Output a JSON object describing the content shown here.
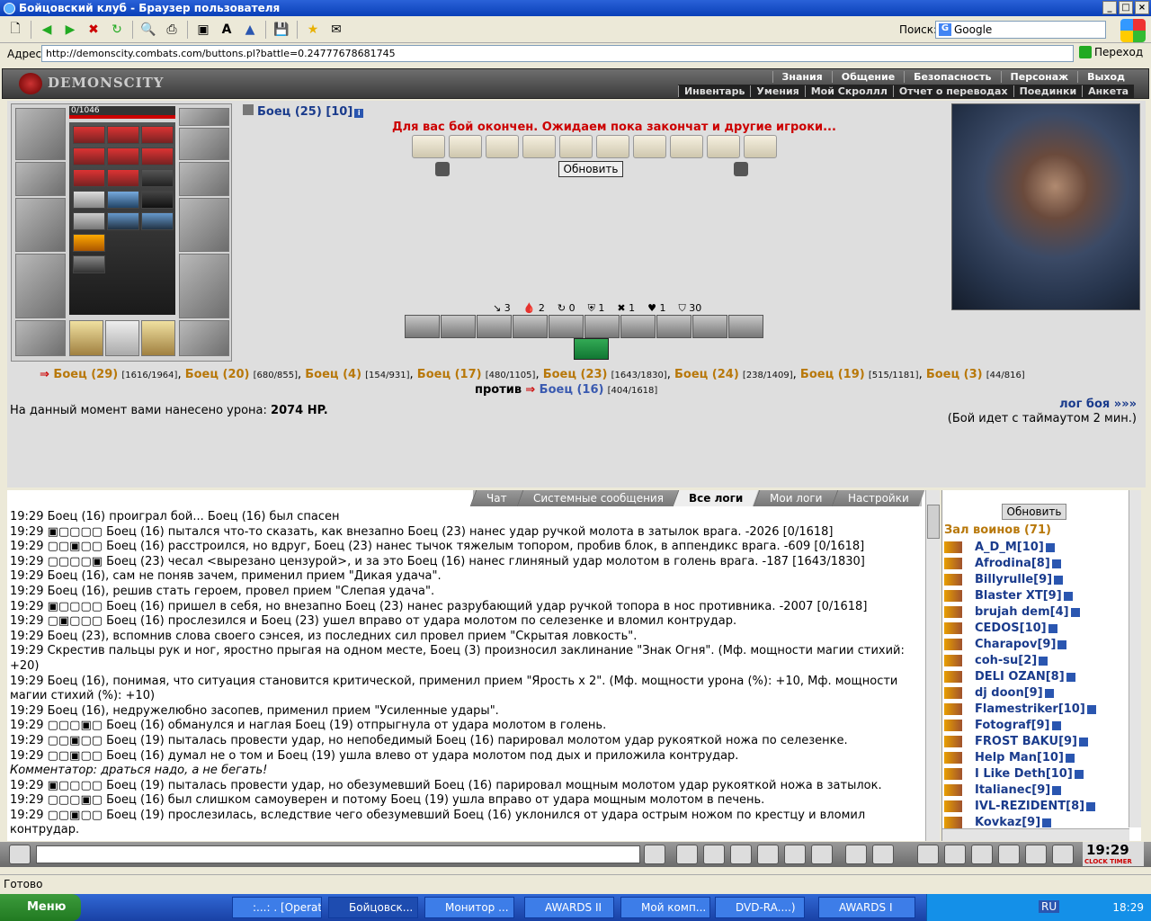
{
  "window": {
    "title": "Бойцовский клуб - Браузер пользователя"
  },
  "search": {
    "label": "Поиск:",
    "engine": "Google"
  },
  "address": {
    "label": "Адрес:",
    "url": "http://demonscity.combats.com/buttons.pl?battle=0.24777678681745",
    "go_label": "Переход"
  },
  "game_header": {
    "logo": "DEMONSCITY",
    "menu_top": [
      "Знания",
      "Общение",
      "Безопасность",
      "Персонаж",
      "Выход"
    ],
    "menu_bottom": [
      "Инвентарь",
      "Умения",
      "Мой Скроллл",
      "Отчет о переводах",
      "Поединки",
      "Анкета"
    ]
  },
  "character": {
    "hp": "0/1046"
  },
  "fighter": {
    "name": "Боец (25) [10]"
  },
  "battle_notice": "Для вас бой окончен. Ожидаем пока закончат и другие игроки...",
  "refresh_button": "Обновить",
  "stats": [
    "3",
    "2",
    "0",
    "1",
    "1",
    "1",
    "30"
  ],
  "team1": [
    {
      "name": "Боец (29)",
      "hp": "[1616/1964]"
    },
    {
      "name": "Боец (20)",
      "hp": "[680/855]"
    },
    {
      "name": "Боец (4)",
      "hp": "[154/931]"
    },
    {
      "name": "Боец (17)",
      "hp": "[480/1105]"
    },
    {
      "name": "Боец (23)",
      "hp": "[1643/1830]"
    },
    {
      "name": "Боец (24)",
      "hp": "[238/1409]"
    },
    {
      "name": "Боец (19)",
      "hp": "[515/1181]"
    },
    {
      "name": "Боец (3)",
      "hp": "[44/816]"
    }
  ],
  "versus_label": "против",
  "team2": [
    {
      "name": "Боец (16)",
      "hp": "[404/1618]"
    }
  ],
  "damage": {
    "label": "На данный момент вами нанесено урона:",
    "value": "2074 HP."
  },
  "log_link": "лог боя »»»",
  "timeout_text": "(Бой идет с таймаутом 2 мин.)",
  "chat_tabs": [
    "Чат",
    "Системные сообщения",
    "Все логи",
    "Мои логи",
    "Настройки"
  ],
  "log_lines": [
    "19:29 Боец (16) проиграл бой... Боец (16) был спасен",
    "19:29 ▣▢▢▢▢ Боец (16) пытался что-то сказать, как внезапно Боец (23) нанес удар ручкой молота в затылок врага. -2026 [0/1618]",
    "19:29 ▢▢▣▢▢ Боец (16) расстроился, но вдруг, Боец (23) нанес тычок тяжелым топором, пробив блок, в аппендикс врага. -609 [0/1618]",
    "19:29 ▢▢▢▢▣ Боец (23) чесал <вырезано цензурой>, и за это Боец (16) нанес глиняный удар молотом в голень врага. -187 [1643/1830]",
    "19:29 Боец (16), сам не поняв зачем, применил прием \"Дикая удача\".",
    "19:29 Боец (16), решив стать героем, провел прием \"Слепая удача\".",
    "19:29 ▣▢▢▢▢ Боец (16) пришел в себя, но внезапно Боец (23) нанес разрубающий удар ручкой топора в нос противника. -2007 [0/1618]",
    "19:29 ▢▣▢▢▢ Боец (16) прослезился и Боец (23) ушел вправо от удара молотом по селезенке и вломил контрудар.",
    "19:29 Боец (23), вспомнив слова своего сэнсея, из последних сил провел прием \"Скрытая ловкость\".",
    "19:29 Скрестив пальцы рук и ног, яростно прыгая на одном месте, Боец (3) произносил заклинание \"Знак Огня\". (Мф. мощности магии стихий: +20)",
    "19:29 Боец (16), понимая, что ситуация становится критической, применил прием \"Ярость x 2\". (Мф. мощности урона (%): +10, Мф. мощности магии стихий (%): +10)",
    "19:29 Боец (16), недружелюбно засопев, применил прием \"Усиленные удары\".",
    "19:29 ▢▢▢▣▢ Боец (16) обманулся и наглая Боец (19) отпрыгнула от удара молотом в голень.",
    "19:29 ▢▢▣▢▢ Боец (19) пыталась провести удар, но непобедимый Боец (16) парировал молотом удар рукояткой ножа по селезенке.",
    "19:29 ▢▢▣▢▢ Боец (16) думал не о том и Боец (19) ушла влево от удара молотом под дых и приложила контрудар.",
    "Комментатор: драться надо, а не бегать!",
    "19:29 ▣▢▢▢▢ Боец (19) пыталась провести удар, но обезумевший Боец (16) парировал мощным молотом удар рукояткой ножа в затылок.",
    "19:29 ▢▢▢▣▢ Боец (16) был слишком самоуверен и потому Боец (19) ушла вправо от удара мощным молотом в печень.",
    "19:29 ▢▢▣▢▢ Боец (19) прослезилась, вследствие чего обезумевший Боец (16) уклонился от удара острым ножом по крестцу и вломил контрудар."
  ],
  "side": {
    "refresh_label": "Обновить",
    "hall_title": "Зал воинов (71)",
    "players": [
      "A_D_M[10]",
      "Afrodina[8]",
      "Billyrulle[9]",
      "Blaster XT[9]",
      "brujah dem[4]",
      "CEDOS[10]",
      "Charapov[9]",
      "coh-su[2]",
      "DELI OZAN[8]",
      "dj doon[9]",
      "Flamestriker[10]",
      "Fotograf[9]",
      "FROST BAKU[9]",
      "Help Man[10]",
      "I Like Deth[10]",
      "Italianec[9]",
      "IVL-REZIDENT[8]",
      "Kovkaz[9]"
    ]
  },
  "clock": {
    "time": "19:29",
    "label": "CLOCK TIMER"
  },
  "statusbar": "Готово",
  "taskbar": {
    "start": "Меню",
    "tasks": [
      ":...: . [Operat",
      "Бойцовск...",
      "Монитор ...",
      "AWARDS II",
      "Мой комп...",
      "DVD-RA....)",
      "AWARDS I"
    ],
    "lang": "RU",
    "time": "18:29"
  }
}
